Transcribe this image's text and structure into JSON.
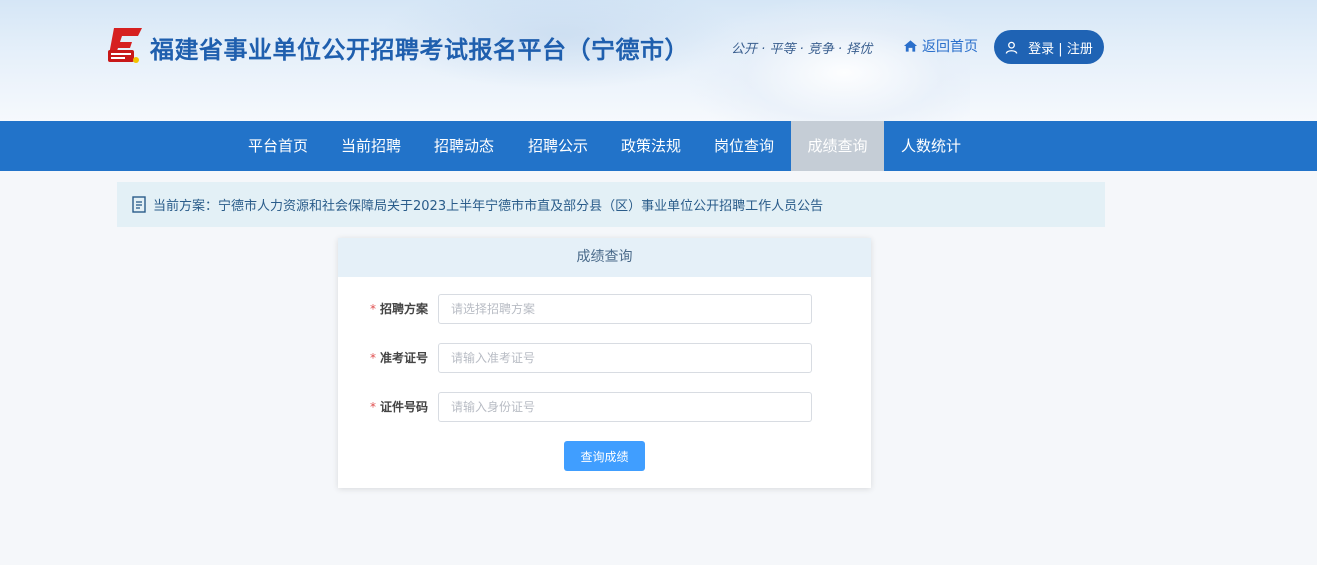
{
  "header": {
    "title": "福建省事业单位公开招聘考试报名平台（宁德市）",
    "slogan": "公开 · 平等 · 竞争 · 择优",
    "home_link": "返回首页",
    "login_label": "登录 | 注册"
  },
  "nav": {
    "items": [
      {
        "label": "平台首页"
      },
      {
        "label": "当前招聘"
      },
      {
        "label": "招聘动态"
      },
      {
        "label": "招聘公示"
      },
      {
        "label": "政策法规"
      },
      {
        "label": "岗位查询"
      },
      {
        "label": "成绩查询"
      },
      {
        "label": "人数统计"
      }
    ],
    "active": "成绩查询"
  },
  "notice": {
    "label": "当前方案：",
    "text": "宁德市人力资源和社会保障局关于2023上半年宁德市市直及部分县（区）事业单位公开招聘工作人员公告"
  },
  "form": {
    "title": "成绩查询",
    "required_mark": "*",
    "fields": [
      {
        "label": "招聘方案",
        "placeholder": "请选择招聘方案",
        "value": ""
      },
      {
        "label": "准考证号",
        "placeholder": "请输入准考证号",
        "value": ""
      },
      {
        "label": "证件号码",
        "placeholder": "请输入身份证号",
        "value": ""
      }
    ],
    "submit_label": "查询成绩"
  },
  "colors": {
    "nav_bg": "#2273c9",
    "nav_active_bg": "#c5cdd6",
    "title": "#1f5fae",
    "login_bg": "#1f63b4",
    "submit_bg": "#409eff",
    "notice_bg": "#e3f0f6"
  },
  "icons": {
    "logo": "red-book-logo",
    "home": "home-icon",
    "user": "user-icon",
    "notice": "document-icon"
  }
}
